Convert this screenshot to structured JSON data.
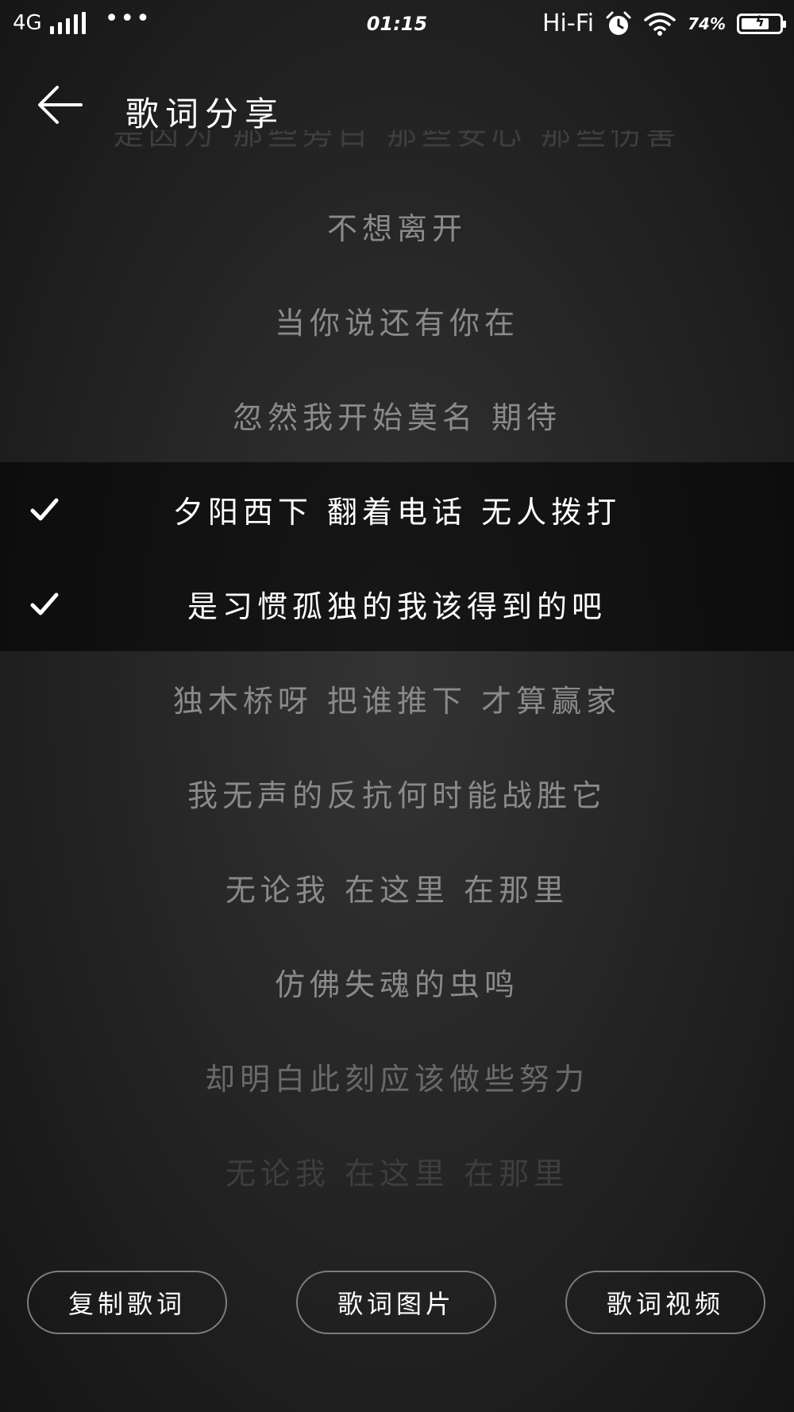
{
  "status_bar": {
    "network": "4G",
    "time": "01:15",
    "hifi": "Hi-Fi",
    "battery_percent": "74%",
    "battery_level": 0.74,
    "icons": [
      "signal-icon",
      "more-dots-icon",
      "alarm-icon",
      "wifi-icon",
      "battery-icon"
    ]
  },
  "header": {
    "title": "歌词分享",
    "back_icon": "back-arrow-icon"
  },
  "lyrics": [
    {
      "text": "是因为 那些旁白 那些安心 那些伤害",
      "selected": false
    },
    {
      "text": "不想离开",
      "selected": false
    },
    {
      "text": "当你说还有你在",
      "selected": false
    },
    {
      "text": "忽然我开始莫名 期待",
      "selected": false
    },
    {
      "text": "夕阳西下 翻着电话 无人拨打",
      "selected": true
    },
    {
      "text": "是习惯孤独的我该得到的吧",
      "selected": true
    },
    {
      "text": "独木桥呀 把谁推下 才算赢家",
      "selected": false
    },
    {
      "text": "我无声的反抗何时能战胜它",
      "selected": false
    },
    {
      "text": "无论我 在这里 在那里",
      "selected": false
    },
    {
      "text": "仿佛失魂的虫鸣",
      "selected": false
    },
    {
      "text": "却明白此刻应该做些努力",
      "selected": false
    },
    {
      "text": "无论我 在这里 在那里",
      "selected": false
    }
  ],
  "actions": {
    "copy_label": "复制歌词",
    "image_label": "歌词图片",
    "video_label": "歌词视频"
  }
}
